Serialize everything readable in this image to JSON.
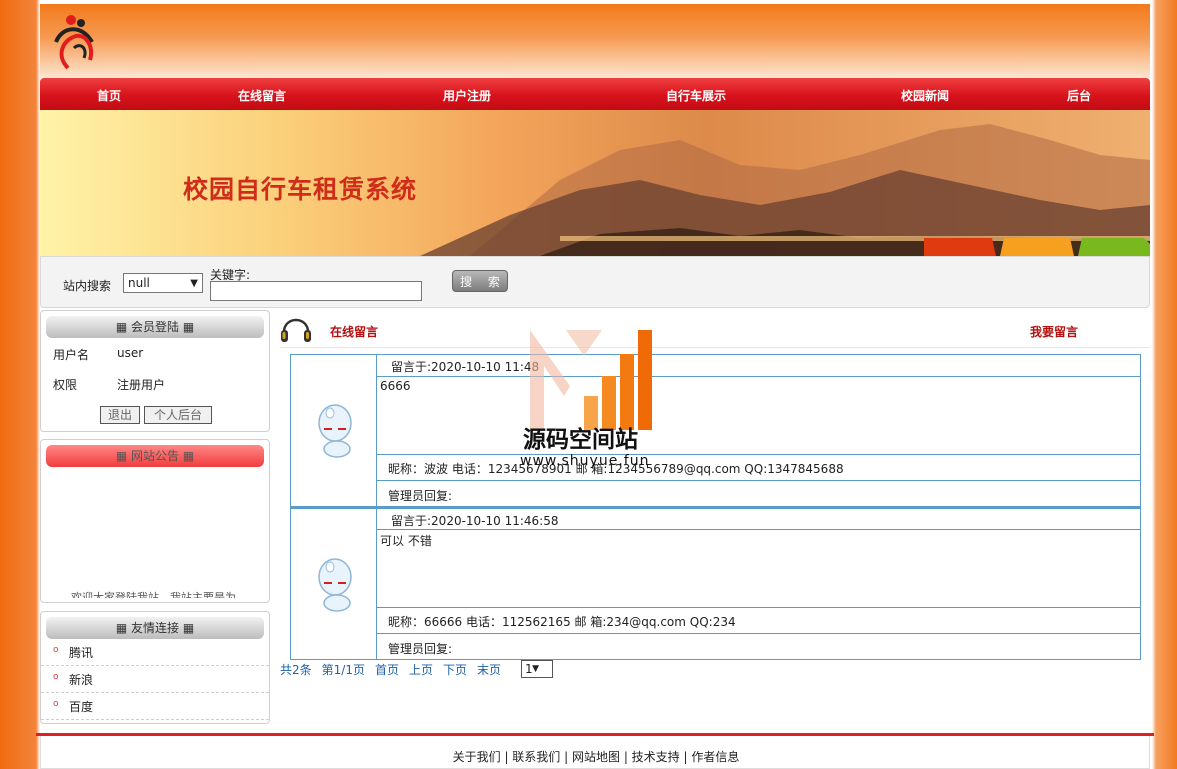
{
  "nav": {
    "items": [
      "首页",
      "在线留言",
      "用户注册",
      "自行车展示",
      "校园新闻",
      "后台"
    ]
  },
  "banner": {
    "title": "校园自行车租赁系统"
  },
  "search": {
    "label": "站内搜索",
    "select_value": "null",
    "keyword_label": "关键字:",
    "button": "搜 索"
  },
  "member": {
    "header": "会员登陆",
    "username_label": "用户名",
    "username_value": "user",
    "role_label": "权限",
    "role_value": "注册用户",
    "logout_button": "退出",
    "profile_button": "个人后台"
  },
  "notice": {
    "header": "网站公告",
    "scroll_text": "欢迎大家登陆我站，我站主要是为"
  },
  "links": {
    "header": "友情连接",
    "items": [
      "腾讯",
      "新浪",
      "百度"
    ]
  },
  "main": {
    "title": "在线留言",
    "write_link": "我要留言"
  },
  "messages": [
    {
      "time": "留言于:2020-10-10 11:48",
      "content": "6666",
      "info": "昵称：波波    电话：12345678901  邮 箱:1234556789@qq.com    QQ:1347845688",
      "reply": "管理员回复:"
    },
    {
      "time": "留言于:2020-10-10 11:46:58",
      "content": "可以 不错",
      "info": "昵称：66666    电话：112562165  邮 箱:234@qq.com    QQ:234",
      "reply": "管理员回复:"
    }
  ],
  "pager": {
    "total": "共2条",
    "page": "第1/1页",
    "first": "首页",
    "prev": "上页",
    "next": "下页",
    "last": "末页",
    "select_value": "1"
  },
  "watermark": {
    "line1": "源码空间站",
    "line2": "www.shuyue.fun"
  },
  "footer": {
    "links": [
      "关于我们",
      "联系我们",
      "网站地图",
      "技术支持",
      "作者信息"
    ]
  },
  "colors": {
    "nav_red": "#d8121c",
    "title_red": "#b31010",
    "table_border": "#5b9bc8",
    "link_blue": "#1e62a8"
  }
}
